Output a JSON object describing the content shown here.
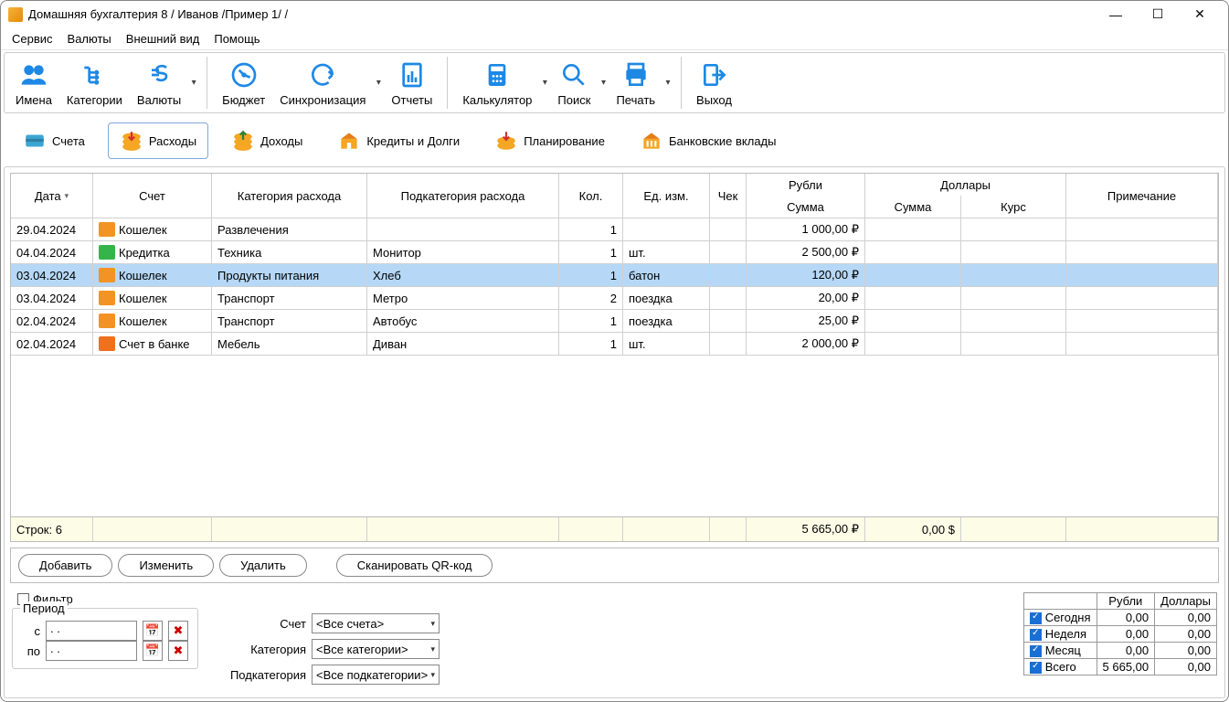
{
  "title": "Домашняя бухгалтерия 8  / Иванов /Пример 1/ /",
  "menu": [
    "Сервис",
    "Валюты",
    "Внешний вид",
    "Помощь"
  ],
  "toolbar": [
    {
      "id": "names",
      "label": "Имена"
    },
    {
      "id": "categories",
      "label": "Категории"
    },
    {
      "id": "currencies",
      "label": "Валюты",
      "dd": true
    },
    {
      "id": "budget",
      "label": "Бюджет",
      "group": 2
    },
    {
      "id": "sync",
      "label": "Синхронизация",
      "dd": true,
      "group": 2
    },
    {
      "id": "reports",
      "label": "Отчеты",
      "group": 2
    },
    {
      "id": "calc",
      "label": "Калькулятор",
      "dd": true,
      "group": 3
    },
    {
      "id": "search",
      "label": "Поиск",
      "dd": true,
      "group": 3
    },
    {
      "id": "print",
      "label": "Печать",
      "dd": true,
      "group": 3
    },
    {
      "id": "exit",
      "label": "Выход",
      "group": 4
    }
  ],
  "sections": [
    {
      "id": "accounts",
      "label": "Счета"
    },
    {
      "id": "expenses",
      "label": "Расходы",
      "active": true
    },
    {
      "id": "income",
      "label": "Доходы"
    },
    {
      "id": "credits",
      "label": "Кредиты и Долги"
    },
    {
      "id": "planning",
      "label": "Планирование"
    },
    {
      "id": "deposits",
      "label": "Банковские вклады"
    }
  ],
  "grid": {
    "head_top": {
      "rub": "Рубли",
      "usd": "Доллары"
    },
    "head": {
      "date": "Дата",
      "acct": "Счет",
      "cat": "Категория расхода",
      "sub": "Подкатегория расхода",
      "qty": "Кол.",
      "um": "Ед. изм.",
      "chk": "Чек",
      "rub": "Сумма",
      "dsum": "Сумма",
      "dkurs": "Курс",
      "note": "Примечание"
    },
    "rows": [
      {
        "date": "29.04.2024",
        "acct": "Кошелек",
        "acct_type": "wallet",
        "cat": "Развлечения",
        "sub": "",
        "qty": "1",
        "um": "",
        "rub": "1 000,00 ₽"
      },
      {
        "date": "04.04.2024",
        "acct": "Кредитка",
        "acct_type": "card",
        "cat": "Техника",
        "sub": "Монитор",
        "qty": "1",
        "um": "шт.",
        "rub": "2 500,00 ₽"
      },
      {
        "date": "03.04.2024",
        "acct": "Кошелек",
        "acct_type": "wallet",
        "cat": "Продукты питания",
        "sub": "Хлеб",
        "qty": "1",
        "um": "батон",
        "rub": "120,00 ₽",
        "selected": true
      },
      {
        "date": "03.04.2024",
        "acct": "Кошелек",
        "acct_type": "wallet",
        "cat": "Транспорт",
        "sub": "Метро",
        "qty": "2",
        "um": "поездка",
        "rub": "20,00 ₽"
      },
      {
        "date": "02.04.2024",
        "acct": "Кошелек",
        "acct_type": "wallet",
        "cat": "Транспорт",
        "sub": "Автобус",
        "qty": "1",
        "um": "поездка",
        "rub": "25,00 ₽"
      },
      {
        "date": "02.04.2024",
        "acct": "Счет в банке",
        "acct_type": "bank",
        "cat": "Мебель",
        "sub": "Диван",
        "qty": "1",
        "um": "шт.",
        "rub": "2 000,00 ₽"
      }
    ],
    "footer": {
      "count": "Строк: 6",
      "rub": "5 665,00 ₽",
      "usd": "0,00 $"
    }
  },
  "buttons": {
    "add": "Добавить",
    "edit": "Изменить",
    "del": "Удалить",
    "qr": "Сканировать QR-код"
  },
  "filter": {
    "label": "Фильтр",
    "period": "Период",
    "from": "с",
    "to": "по",
    "date_placeholder": "  .  .",
    "acct_label": "Счет",
    "acct_val": "<Все счета>",
    "cat_label": "Категория",
    "cat_val": "<Все категории>",
    "sub_label": "Подкатегория",
    "sub_val": "<Все подкатегории>"
  },
  "summary": {
    "head_rub": "Рубли",
    "head_usd": "Доллары",
    "rows": [
      {
        "label": "Сегодня",
        "rub": "0,00",
        "usd": "0,00"
      },
      {
        "label": "Неделя",
        "rub": "0,00",
        "usd": "0,00"
      },
      {
        "label": "Месяц",
        "rub": "0,00",
        "usd": "0,00"
      },
      {
        "label": "Всего",
        "rub": "5 665,00",
        "usd": "0,00"
      }
    ]
  }
}
